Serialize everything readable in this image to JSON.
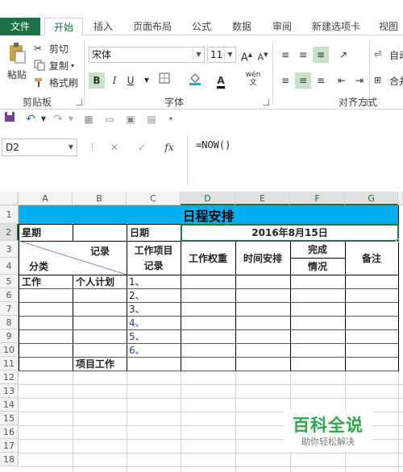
{
  "tabs": [
    "文件",
    "开始",
    "插入",
    "页面布局",
    "公式",
    "数据",
    "审阅",
    "新建选项卡",
    "视图"
  ],
  "clipboard": {
    "paste": "粘贴",
    "cut": "剪切",
    "copy": "复制",
    "format_painter": "格式刷",
    "group": "剪贴板"
  },
  "font": {
    "name": "宋体",
    "size": "11",
    "group": "字体",
    "bold": "B",
    "italic": "I",
    "underline": "U",
    "color_letter": "A",
    "phonetic": "wén",
    "phonetic_char": "文"
  },
  "alignment": {
    "group": "对齐方式",
    "wrap": "自动",
    "merge": "合并"
  },
  "formula_bar": {
    "name_box": "D2",
    "cancel": "✕",
    "enter": "✓",
    "fx": "fx",
    "formula": "=NOW()"
  },
  "columns": [
    "A",
    "B",
    "C",
    "D",
    "E",
    "F",
    "G"
  ],
  "rows": [
    "1",
    "2",
    "3",
    "4",
    "5",
    "6",
    "7",
    "8",
    "9",
    "10",
    "11",
    "12",
    "13",
    "14",
    "15",
    "16",
    "17",
    "18"
  ],
  "sheet": {
    "title": "日程安排",
    "weekday_label": "星期",
    "date_label": "日期",
    "date_value": "2016年8月15日",
    "record_label": "记录",
    "category_label": "分类",
    "work_item_line1": "工作项目",
    "work_item_line2": "记录",
    "weight": "工作权重",
    "time": "时间安排",
    "done_line1": "完成",
    "done_line2": "情况",
    "remark": "备注",
    "work": "工作",
    "personal_plan": "个人计划",
    "project_work": "项目工作",
    "items": [
      "1、",
      "2、",
      "3、",
      "4、",
      "5、",
      "6、"
    ]
  },
  "watermark": {
    "title": "百科全说",
    "subtitle": "助你轻松解决"
  },
  "colors": {
    "accent": "#1e7145",
    "title_fill": "#00b0f0",
    "blue_text": "#1f3fbf"
  }
}
